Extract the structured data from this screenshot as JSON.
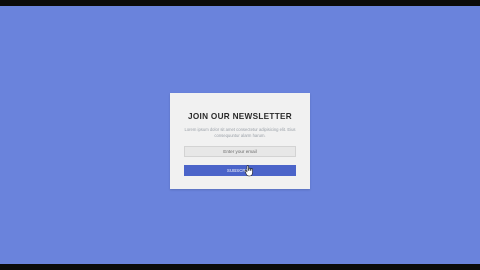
{
  "newsletter": {
    "title": "JOIN OUR NEWSLETTER",
    "description": "Lorem ipsum dolor sit amet consectetur adipisicing elit. Eius consequuntur alarm harum.",
    "email_placeholder": "Enter your email",
    "subscribe_label": "SUBSCRIBE"
  },
  "colors": {
    "background": "#6a83dc",
    "card": "#f1f1f1",
    "button": "#4b64c9"
  },
  "icons": {
    "cursor": "hand-pointer-icon"
  }
}
